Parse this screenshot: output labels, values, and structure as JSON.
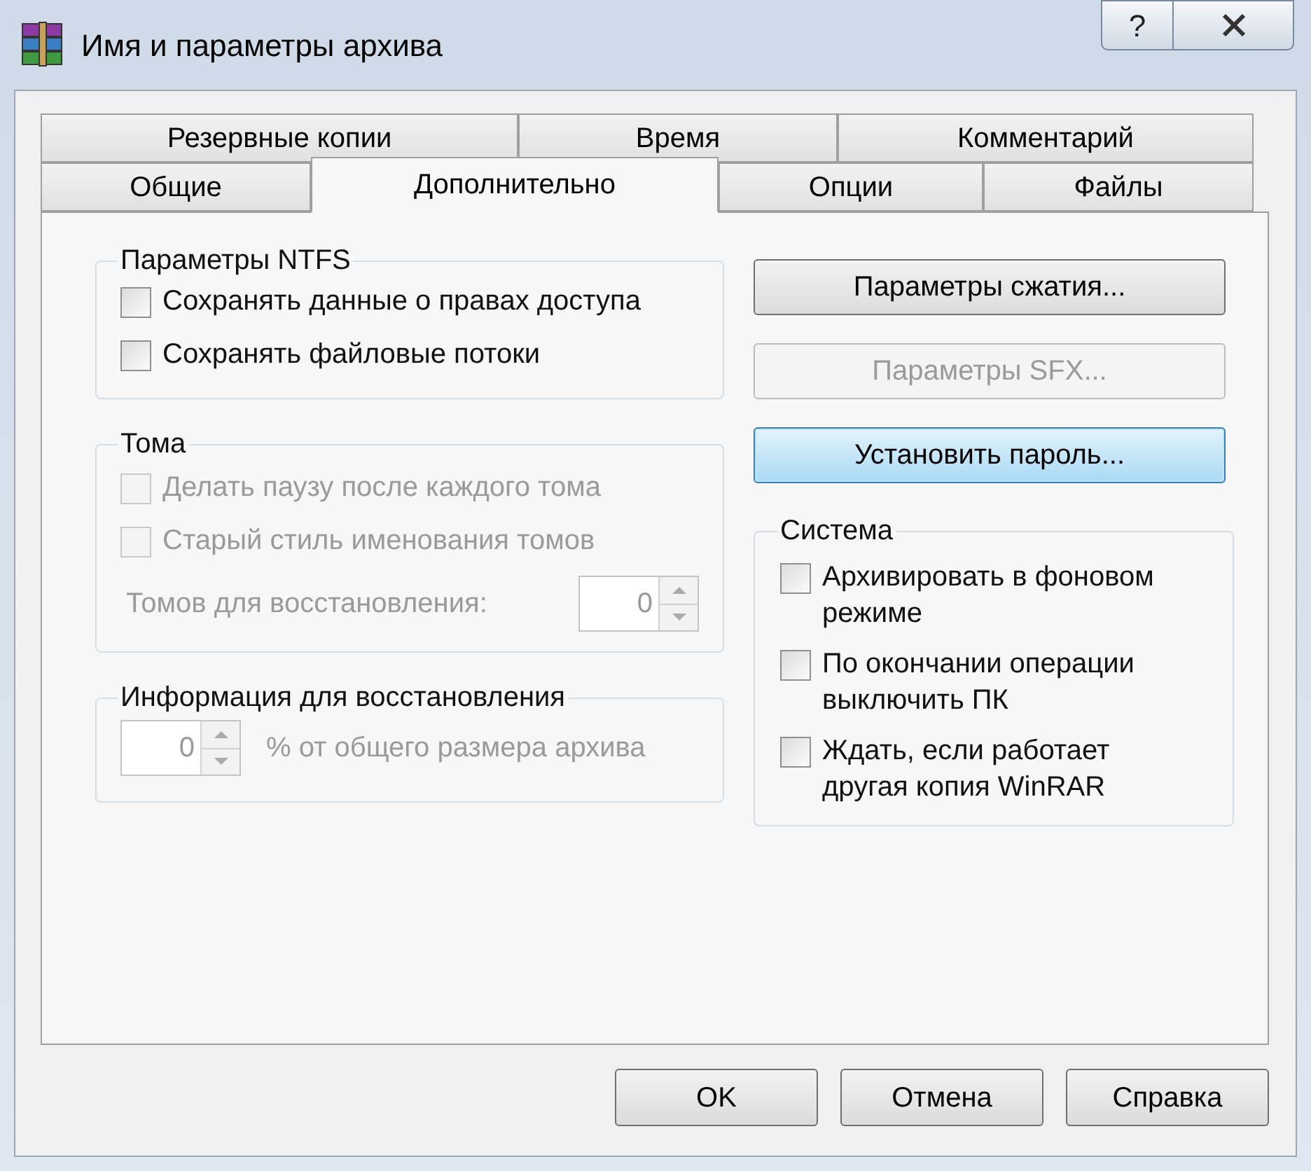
{
  "window": {
    "title": "Имя и параметры архива",
    "help_button": "?"
  },
  "tab_rows": [
    [
      {
        "label": "Резервные копии",
        "selected": false
      },
      {
        "label": "Время",
        "selected": false
      },
      {
        "label": "Комментарий",
        "selected": false
      }
    ],
    [
      {
        "label": "Общие",
        "selected": false
      },
      {
        "label": "Дополнительно",
        "selected": true
      },
      {
        "label": "Опции",
        "selected": false
      },
      {
        "label": "Файлы",
        "selected": false
      }
    ]
  ],
  "ntfs": {
    "title": "Параметры NTFS",
    "options": [
      {
        "label": "Сохранять данные о правах доступа",
        "checked": false,
        "disabled": false
      },
      {
        "label": "Сохранять файловые потоки",
        "checked": false,
        "disabled": false
      }
    ]
  },
  "volumes": {
    "title": "Тома",
    "options": [
      {
        "label": "Делать паузу после каждого тома",
        "checked": false,
        "disabled": true
      },
      {
        "label": "Старый стиль именования томов",
        "checked": false,
        "disabled": true
      }
    ],
    "count_label": "Томов для восстановления:",
    "count_value": "0",
    "disabled": true
  },
  "recovery": {
    "title": "Информация для восстановления",
    "value": "0",
    "suffix": "% от общего размера архива",
    "disabled": true
  },
  "actions": [
    {
      "label": "Параметры сжатия...",
      "disabled": false,
      "focused": false
    },
    {
      "label": "Параметры SFX...",
      "disabled": true,
      "focused": false
    },
    {
      "label": "Установить пароль...",
      "disabled": false,
      "focused": true
    }
  ],
  "system": {
    "title": "Система",
    "options": [
      {
        "label": "Архивировать в фоновом режиме",
        "checked": false,
        "disabled": false
      },
      {
        "label": "По окончании операции выключить ПК",
        "checked": false,
        "disabled": false
      },
      {
        "label": "Ждать, если работает другая копия WinRAR",
        "checked": false,
        "disabled": false
      }
    ]
  },
  "buttons": [
    "OK",
    "Отмена",
    "Справка"
  ]
}
